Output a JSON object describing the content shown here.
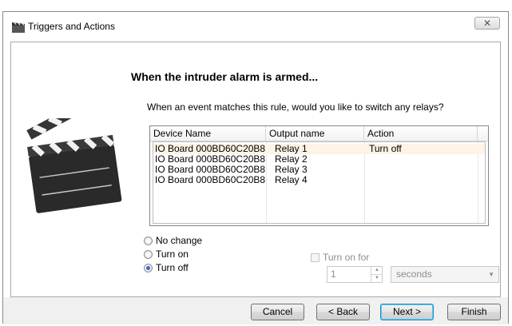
{
  "window": {
    "title": "Triggers and Actions",
    "close_label": "✕"
  },
  "wizard": {
    "heading": "When the intruder alarm is armed...",
    "question": "When an event matches this rule, would you like to switch any relays?"
  },
  "relay_table": {
    "columns": [
      "Device Name",
      "Output name",
      "Action"
    ],
    "rows": [
      {
        "device": "IO Board 000BD60C20B8",
        "output": "Relay 1",
        "action": "Turn off"
      },
      {
        "device": "IO Board 000BD60C20B8",
        "output": "Relay 2",
        "action": ""
      },
      {
        "device": "IO Board 000BD60C20B8",
        "output": "Relay 3",
        "action": ""
      },
      {
        "device": "IO Board 000BD60C20B8",
        "output": "Relay 4",
        "action": ""
      }
    ]
  },
  "options": {
    "no_change": "No change",
    "turn_on": "Turn on",
    "turn_off": "Turn off",
    "selected": "Turn off",
    "turn_on_for": "Turn on for",
    "turn_on_for_checked": false,
    "duration_value": "1",
    "duration_unit": "seconds"
  },
  "footer": {
    "cancel": "Cancel",
    "back": "< Back",
    "next": "Next >",
    "finish": "Finish"
  }
}
